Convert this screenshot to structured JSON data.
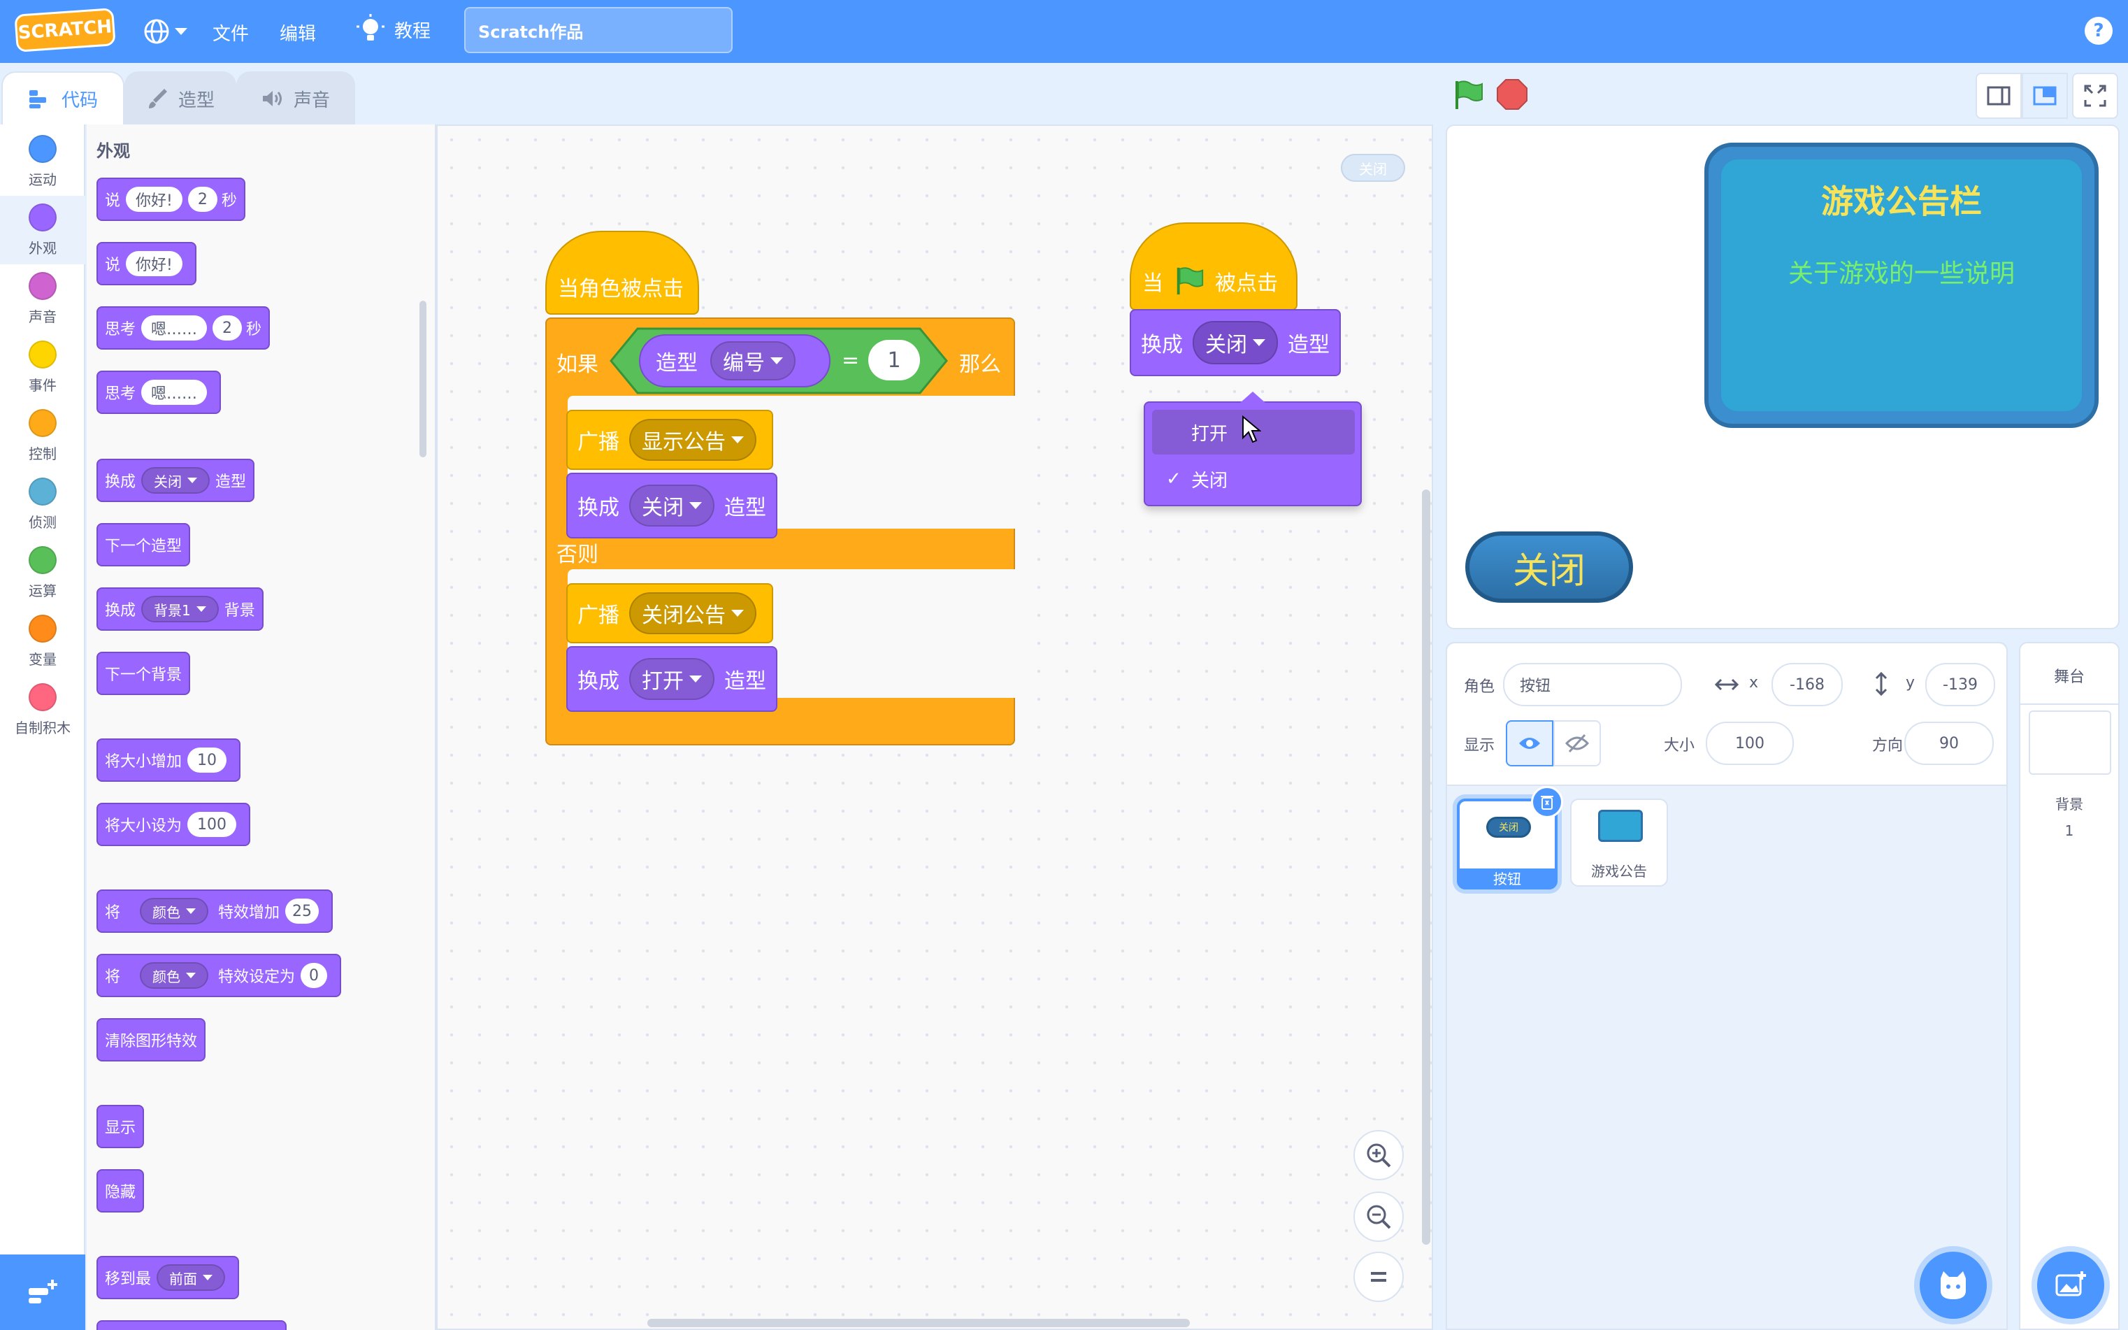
{
  "menubar": {
    "logo": "SCRATCH",
    "file": "文件",
    "edit": "编辑",
    "tutorials": "教程",
    "project_title": "Scratch作品",
    "help": "?"
  },
  "tabs": [
    {
      "label": "代码",
      "icon": "code-icon"
    },
    {
      "label": "造型",
      "icon": "brush-icon"
    },
    {
      "label": "声音",
      "icon": "speaker-icon"
    }
  ],
  "categories": [
    {
      "label": "运动",
      "color": "#4c97ff"
    },
    {
      "label": "外观",
      "color": "#9966ff"
    },
    {
      "label": "声音",
      "color": "#cf63cf"
    },
    {
      "label": "事件",
      "color": "#ffd500"
    },
    {
      "label": "控制",
      "color": "#ffab19"
    },
    {
      "label": "侦测",
      "color": "#5cb1d6"
    },
    {
      "label": "运算",
      "color": "#59c059"
    },
    {
      "label": "变量",
      "color": "#ff8c1a"
    },
    {
      "label": "自制积木",
      "color": "#ff6680"
    }
  ],
  "palette": {
    "heading": "外观",
    "say_secs": {
      "say": "说",
      "msg": "你好!",
      "secs": "2",
      "unit": "秒"
    },
    "say": {
      "say": "说",
      "msg": "你好!"
    },
    "think_secs": {
      "think": "思考",
      "msg": "嗯……",
      "secs": "2",
      "unit": "秒"
    },
    "think": {
      "think": "思考",
      "msg": "嗯……"
    },
    "switch_costume": {
      "a": "换成",
      "val": "关闭",
      "b": "造型"
    },
    "next_costume": "下一个造型",
    "switch_backdrop": {
      "a": "换成",
      "val": "背景1",
      "b": "背景"
    },
    "next_backdrop": "下一个背景",
    "change_size": {
      "a": "将大小增加",
      "val": "10"
    },
    "set_size": {
      "a": "将大小设为",
      "val": "100"
    },
    "change_effect": {
      "a": "将",
      "effect": "颜色",
      "b": "特效增加",
      "val": "25"
    },
    "set_effect": {
      "a": "将",
      "effect": "颜色",
      "b": "特效设定为",
      "val": "0"
    },
    "clear_effects": "清除图形特效",
    "show": "显示",
    "hide": "隐藏",
    "go_to": {
      "a": "移到最",
      "val": "前面"
    }
  },
  "script1": {
    "hat": "当角色被点击",
    "if": "如果",
    "costume": "造型",
    "costume_prop": "编号",
    "eq": "=",
    "eq_val": "1",
    "then": "那么",
    "broadcast1": {
      "a": "广播",
      "val": "显示公告"
    },
    "switch1": {
      "a": "换成",
      "val": "关闭",
      "b": "造型"
    },
    "else": "否则",
    "broadcast2": {
      "a": "广播",
      "val": "关闭公告"
    },
    "switch2": {
      "a": "换成",
      "val": "打开",
      "b": "造型"
    }
  },
  "script2": {
    "hat_a": "当",
    "hat_b": "被点击",
    "switch": {
      "a": "换成",
      "val": "关闭",
      "b": "造型"
    }
  },
  "dropdown": {
    "options": [
      {
        "label": "打开",
        "checked": false,
        "highlighted": true
      },
      {
        "label": "关闭",
        "checked": true,
        "highlighted": false
      }
    ],
    "check": "✓"
  },
  "workspace_badge": "关闭",
  "stage": {
    "notice_title": "游戏公告栏",
    "notice_body": "关于游戏的一些说明",
    "button_label": "关闭"
  },
  "sprite_info": {
    "sprite_label": "角色",
    "sprite_name": "按钮",
    "x_label": "x",
    "x": "-168",
    "y_label": "y",
    "y": "-139",
    "show_label": "显示",
    "size_label": "大小",
    "size": "100",
    "direction_label": "方向",
    "direction": "90"
  },
  "sprites": [
    {
      "name": "按钮",
      "thumb_text": "关闭",
      "selected": true
    },
    {
      "name": "游戏公告",
      "selected": false
    }
  ],
  "stage_panel": {
    "title": "舞台",
    "backdrops_label": "背景",
    "backdrops_count": "1"
  }
}
